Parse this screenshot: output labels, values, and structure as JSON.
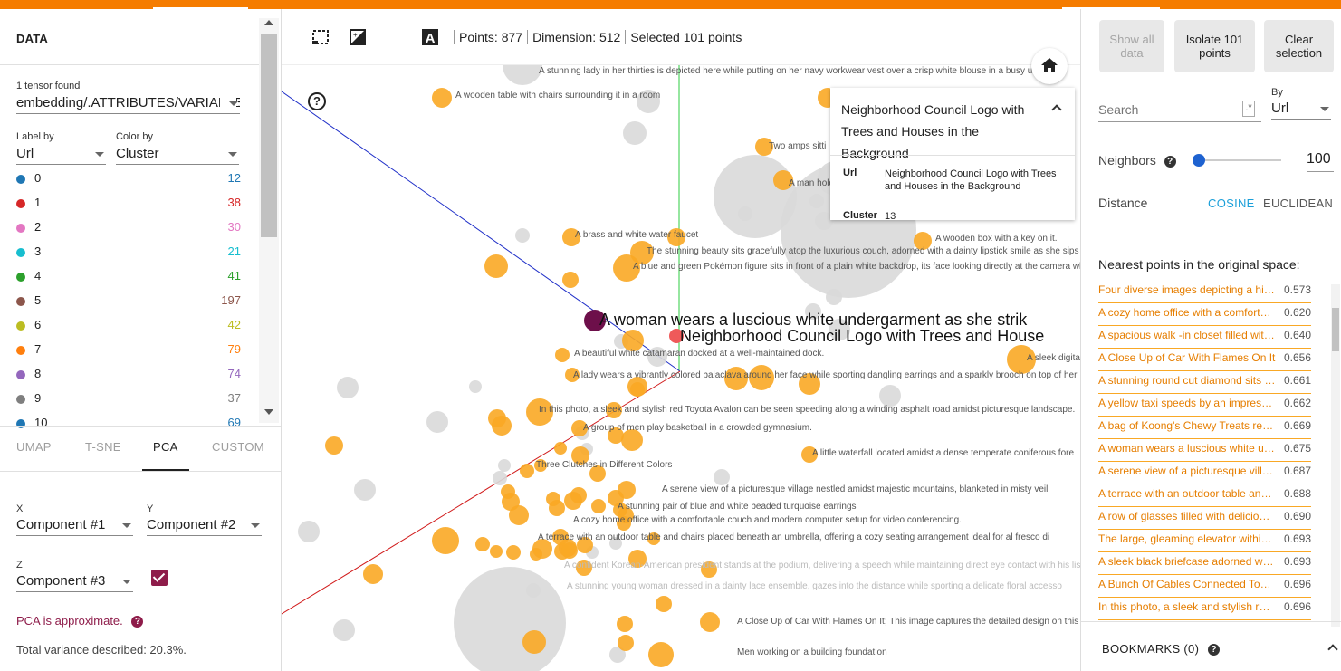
{
  "left_panel": {
    "title": "DATA",
    "tensors_found": "1 tensor found",
    "tensor_name": "embedding/.ATTRIBUTES/VARIABLE_VALUE",
    "label_by_label": "Label by",
    "label_by_value": "Url",
    "color_by_label": "Color by",
    "color_by_value": "Cluster",
    "legend": [
      {
        "label": "0",
        "count": "12",
        "color": "#1f77b4"
      },
      {
        "label": "1",
        "count": "38",
        "color": "#d62728"
      },
      {
        "label": "2",
        "count": "30",
        "color": "#e377c2"
      },
      {
        "label": "3",
        "count": "21",
        "color": "#17becf"
      },
      {
        "label": "4",
        "count": "41",
        "color": "#2ca02c"
      },
      {
        "label": "5",
        "count": "197",
        "color": "#8c564b"
      },
      {
        "label": "6",
        "count": "42",
        "color": "#bcbd22"
      },
      {
        "label": "7",
        "count": "79",
        "color": "#ff7f0e"
      },
      {
        "label": "8",
        "count": "74",
        "color": "#9467bd"
      },
      {
        "label": "9",
        "count": "37",
        "color": "#7f7f7f"
      },
      {
        "label": "10",
        "count": "69",
        "color": "#1f77b4"
      }
    ],
    "projection_tabs": [
      "UMAP",
      "T-SNE",
      "PCA",
      "CUSTOM"
    ],
    "active_tab": "PCA",
    "x_label": "X",
    "x_value": "Component #1",
    "y_label": "Y",
    "y_value": "Component #2",
    "z_label": "Z",
    "z_value": "Component #3",
    "pca_note": "PCA is approximate.",
    "variance": "Total variance described: 20.3%."
  },
  "toolbar": {
    "points": "Points: 877",
    "dimension": "Dimension: 512",
    "selected": "Selected 101 points"
  },
  "info_card": {
    "title": "Neighborhood Council Logo with Trees and Houses in the Background",
    "url_key": "Url",
    "url_value": "Neighborhood Council Logo with Trees and Houses in the Background",
    "cluster_key": "Cluster",
    "cluster_value": "13"
  },
  "scatter": {
    "highlight_label": "A woman wears a luscious white  undergarment as she strik",
    "selected_label": "Neighborhood Council Logo with Trees and House",
    "labels": [
      "A stunning lady in her thirties is depicted here while putting on her navy workwear vest over a crisp white blouse in a busy un",
      "A wooden table with chairs surrounding it in a room",
      "Two amps sitti",
      "A man hold",
      "A brass and white water faucet",
      "A wooden box with a key on it.",
      "The stunning beauty sits gracefully atop the luxurious couch, adorned with a dainty lipstick smile as she sips",
      "A blue and green Pokémon figure sits in front of a plain white backdrop, its face looking directly at the camera wh",
      "A beautiful white catamaran docked at a well-maintained dock.",
      "A sleek digita",
      "A lady wears a vibrantly colored balaclava around her face while sporting dangling earrings and a sparkly brooch on top of her",
      "In this photo, a sleek and stylish red Toyota Avalon can be seen speeding along a winding asphalt road amidst picturesque landscape.",
      "A group of men play basketball in a crowded gymnasium.",
      "A little waterfall located amidst a dense temperate coniferous fore",
      "Three Clutches in Different Colors",
      "A serene view of a picturesque village nestled amidst majestic mountains, blanketed in misty veil",
      "A stunning pair of blue and white beaded turquoise earrings",
      "A cozy home office with a comfortable couch and modern computer setup for video conferencing.",
      "A terrace with an outdoor table and chairs placed beneath an umbrella, offering a cozy seating arrangement ideal for al fresco di",
      "A confident Korean-American president stands at the podium, delivering a speech while maintaining direct eye contact with his listeners",
      "A stunning young woman dressed in a dainty lace ensemble, gazes into the distance while sporting a delicate floral accesso",
      "A Close Up of Car With Flames On It; This image captures the detailed design on this vir",
      "Men working on a building foundation",
      "A woman wears a luscious white undergarment as she strikes a pose"
    ]
  },
  "right_panel": {
    "show_all": "Show all data",
    "isolate": "Isolate 101 points",
    "clear": "Clear selection",
    "search_placeholder": "Search",
    "regex": ".*",
    "by_label": "By",
    "by_value": "Url",
    "neighbors_label": "Neighbors",
    "neighbors_value": "100",
    "neighbors_fraction": 0.04,
    "distance_label": "Distance",
    "cosine": "COSINE",
    "euclidean": "EUCLIDEAN",
    "nearest_title": "Nearest points in the original space:",
    "nearest": [
      {
        "text": "Four diverse images depicting a higher education institution",
        "value": "0.573"
      },
      {
        "text": "A cozy home office with a comfortable couch",
        "value": "0.620"
      },
      {
        "text": "A spacious walk -in closet filled with clothes",
        "value": "0.640"
      },
      {
        "text": "A Close Up of Car With Flames On It",
        "value": "0.656"
      },
      {
        "text": "A stunning round cut diamond sits on a ring",
        "value": "0.661"
      },
      {
        "text": "A yellow taxi speeds by an impressive building",
        "value": "0.662"
      },
      {
        "text": "A bag of Koong's Chewy Treats rests on a table",
        "value": "0.669"
      },
      {
        "text": "A woman wears a luscious white undergarment",
        "value": "0.675"
      },
      {
        "text": "A serene view of a picturesque village",
        "value": "0.687"
      },
      {
        "text": "A terrace with an outdoor table and chairs",
        "value": "0.688"
      },
      {
        "text": "A row of glasses filled with delicious drinks",
        "value": "0.690"
      },
      {
        "text": "The large, gleaming elevator within the lobby",
        "value": "0.693"
      },
      {
        "text": "A sleek black briefcase adorned with gold",
        "value": "0.693"
      },
      {
        "text": "A Bunch Of Cables Connected Together",
        "value": "0.696"
      },
      {
        "text": "In this photo, a sleek and stylish red Toyota Avalon",
        "value": "0.696"
      }
    ],
    "bookmarks": "BOOKMARKS (0)"
  },
  "colors": {
    "accent": "#f57c00",
    "selected_point": "#f9a825",
    "highlight_point": "#6d0f4a",
    "pca_purple": "#8e1c4a",
    "link_orange": "#e67e00",
    "cosine_blue": "#1a9fd9"
  }
}
